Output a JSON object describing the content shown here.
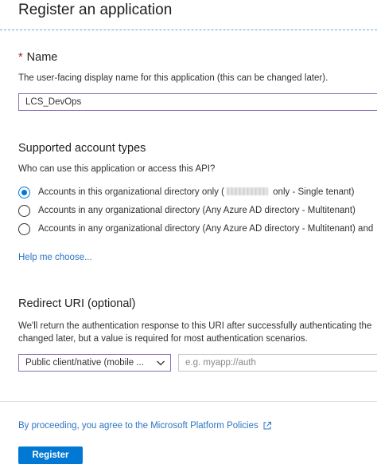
{
  "page": {
    "title": "Register an application"
  },
  "name_section": {
    "required_marker": "*",
    "heading": "Name",
    "description": "The user-facing display name for this application (this can be changed later).",
    "input_value": "LCS_DevOps"
  },
  "account_types": {
    "heading": "Supported account types",
    "question": "Who can use this application or access this API?",
    "options": [
      {
        "label_prefix": "Accounts in this organizational directory only (",
        "label_suffix": " only - Single tenant)",
        "checked": true
      },
      {
        "label": "Accounts in any organizational directory (Any Azure AD directory - Multitenant)",
        "checked": false
      },
      {
        "label": "Accounts in any organizational directory (Any Azure AD directory - Multitenant) and",
        "checked": false
      }
    ],
    "help_link": "Help me choose..."
  },
  "redirect": {
    "heading": "Redirect URI (optional)",
    "description": "We'll return the authentication response to this URI after successfully authenticating the changed later, but a value is required for most authentication scenarios.",
    "platform_select_value": "Public client/native (mobile ...",
    "uri_placeholder": "e.g. myapp://auth"
  },
  "footer": {
    "policy_text": "By proceeding, you agree to the Microsoft Platform Policies",
    "register_label": "Register"
  },
  "icons": {
    "chevron": "chevron-down-icon",
    "external": "external-link-icon"
  },
  "colors": {
    "accent": "#0078d4",
    "link": "#2d74c3",
    "required": "#a4262c",
    "focus_border": "#8a6fb5"
  }
}
